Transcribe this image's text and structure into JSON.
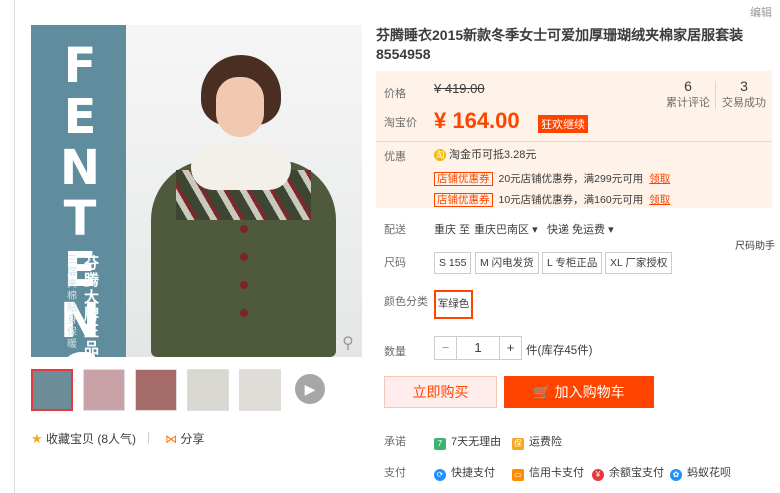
{
  "toolbar": {
    "edit_label": "编辑"
  },
  "product": {
    "title": "芬腾睡衣2015新款冬季女士可爱加厚珊瑚绒夹棉家居服套装 8554958",
    "brand_text": "FENTENG",
    "brand_cn": "芬腾大牌正品",
    "brand_sub": "三层夹棉 贴身保暖"
  },
  "price": {
    "orig_label": "价格",
    "orig_value": "¥ 419.00",
    "tb_label": "淘宝价",
    "tb_value": "¥ 164.00",
    "promo_tag": "狂欢继续",
    "reviews_count": "6",
    "reviews_label": "累计评论",
    "sales_count": "3",
    "sales_label": "交易成功"
  },
  "promo": {
    "label": "优惠",
    "coin_text": "淘金币可抵3.28元",
    "coupons": [
      {
        "tag": "店铺优惠券",
        "text": "20元店铺优惠券，满299元可用",
        "get": "领取"
      },
      {
        "tag": "店铺优惠券",
        "text": "10元店铺优惠券，满160元可用",
        "get": "领取"
      }
    ]
  },
  "delivery": {
    "label": "配送",
    "from": "重庆 至",
    "to": "重庆巴南区",
    "shipping": "快递 免运费"
  },
  "size": {
    "label": "尺码",
    "options": [
      "S 155",
      "M 闪电发货",
      "L 专柜正品",
      "XL 厂家授权"
    ],
    "assistant": "尺码助手"
  },
  "color": {
    "label": "颜色分类",
    "selected": "军绿色"
  },
  "quantity": {
    "label": "数量",
    "minus": "−",
    "value": "1",
    "plus": "+",
    "stock": "件(库存45件)"
  },
  "actions": {
    "buy_now": "立即购买",
    "add_cart": "加入购物车"
  },
  "services": {
    "promise_label": "承诺",
    "promise1": "7天无理由",
    "promise2": "运费险",
    "pay_label": "支付",
    "pay1": "快捷支付",
    "pay2": "信用卡支付",
    "pay3": "余额宝支付",
    "pay4": "蚂蚁花呗"
  },
  "social": {
    "fav": "收藏宝贝",
    "fav_count": "(8人气)",
    "share": "分享"
  },
  "colors": {
    "accent": "#ff4400",
    "price_bg": "#fff2e8"
  }
}
